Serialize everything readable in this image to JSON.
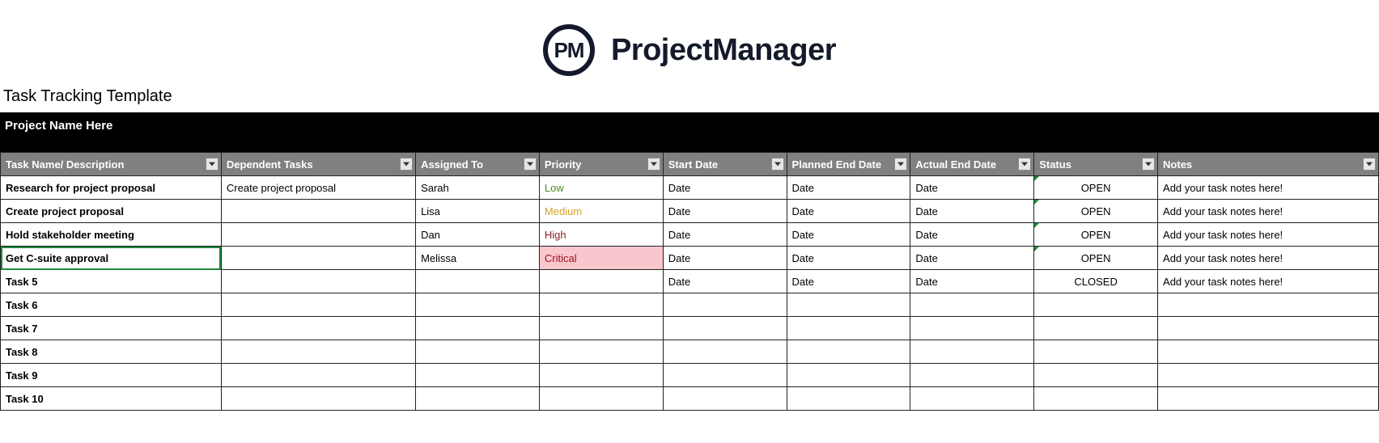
{
  "logo": {
    "badge": "PM",
    "text": "ProjectManager"
  },
  "subtitle": "Task Tracking Template",
  "project_name": "Project Name Here",
  "headers": {
    "task": "Task Name/ Description",
    "dep": "Dependent Tasks",
    "asg": "Assigned To",
    "pri": "Priority",
    "sd": "Start Date",
    "ped": "Planned End Date",
    "aed": "Actual End Date",
    "stat": "Status",
    "notes": "Notes"
  },
  "rows": [
    {
      "task": "Research for project proposal",
      "dep": "Create project proposal",
      "asg": "Sarah",
      "pri": "Low",
      "sd": "Date",
      "ped": "Date",
      "aed": "Date",
      "stat": "OPEN",
      "notes": "Add your task notes here!"
    },
    {
      "task": "Create project proposal",
      "dep": "",
      "asg": "Lisa",
      "pri": "Medium",
      "sd": "Date",
      "ped": "Date",
      "aed": "Date",
      "stat": "OPEN",
      "notes": "Add your task notes here!"
    },
    {
      "task": "Hold stakeholder meeting",
      "dep": "",
      "asg": "Dan",
      "pri": "High",
      "sd": "Date",
      "ped": "Date",
      "aed": "Date",
      "stat": "OPEN",
      "notes": "Add your task notes here!"
    },
    {
      "task": "Get C-suite approval",
      "dep": "",
      "asg": "Melissa",
      "pri": "Critical",
      "sd": "Date",
      "ped": "Date",
      "aed": "Date",
      "stat": "OPEN",
      "notes": "Add your task notes here!"
    },
    {
      "task": "Task 5",
      "dep": "",
      "asg": "",
      "pri": "",
      "sd": "Date",
      "ped": "Date",
      "aed": "Date",
      "stat": "CLOSED",
      "notes": "Add your task notes here!"
    },
    {
      "task": "Task 6",
      "dep": "",
      "asg": "",
      "pri": "",
      "sd": "",
      "ped": "",
      "aed": "",
      "stat": "",
      "notes": ""
    },
    {
      "task": "Task 7",
      "dep": "",
      "asg": "",
      "pri": "",
      "sd": "",
      "ped": "",
      "aed": "",
      "stat": "",
      "notes": ""
    },
    {
      "task": "Task 8",
      "dep": "",
      "asg": "",
      "pri": "",
      "sd": "",
      "ped": "",
      "aed": "",
      "stat": "",
      "notes": ""
    },
    {
      "task": "Task 9",
      "dep": "",
      "asg": "",
      "pri": "",
      "sd": "",
      "ped": "",
      "aed": "",
      "stat": "",
      "notes": ""
    },
    {
      "task": "Task 10",
      "dep": "",
      "asg": "",
      "pri": "",
      "sd": "",
      "ped": "",
      "aed": "",
      "stat": "",
      "notes": ""
    }
  ]
}
